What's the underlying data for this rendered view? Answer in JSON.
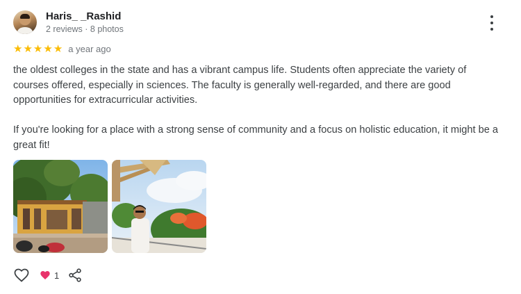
{
  "reviewer": {
    "name": "Haris_ _Rashid",
    "meta": "2 reviews · 8 photos"
  },
  "rating": {
    "stars": 5,
    "star_glyph": "★",
    "time": "a year ago"
  },
  "review": {
    "paragraphs": [
      "the oldest colleges in the state and has a vibrant campus life. Students often appreciate the variety of courses offered, especially in sciences. The faculty is generally well-regarded, and there are good opportunities for extracurricular activities.",
      "If you're looking for a place with a strong sense of community and a focus on holistic education, it might be a great fit!"
    ]
  },
  "photos": [
    {
      "icon": "college-campus-photo"
    },
    {
      "icon": "person-terrace-photo"
    }
  ],
  "actions": {
    "like_count": "1"
  },
  "colors": {
    "star": "#fbbc04",
    "heart_filled": "#e8336b",
    "meta_text": "#70757a"
  }
}
